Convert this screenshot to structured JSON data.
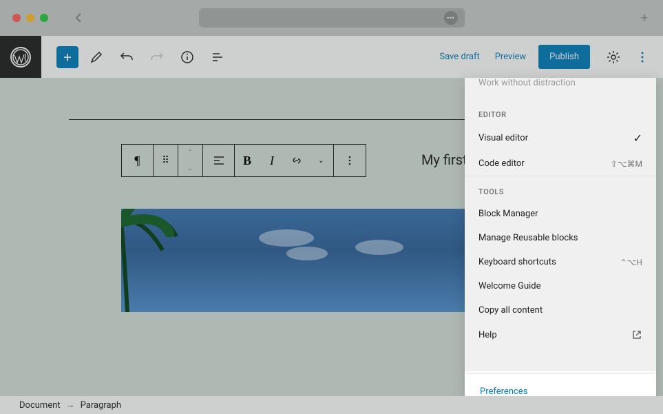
{
  "toolbar": {
    "save_draft": "Save draft",
    "preview": "Preview",
    "publish": "Publish"
  },
  "content": {
    "paragraph": "My first paragraph!"
  },
  "dropdown": {
    "distraction": "Work without distraction",
    "editor_header": "EDITOR",
    "visual_editor": "Visual editor",
    "code_editor": "Code editor",
    "code_editor_shortcut": "⇧⌥⌘M",
    "tools_header": "TOOLS",
    "block_manager": "Block Manager",
    "reusable": "Manage Reusable blocks",
    "shortcuts": "Keyboard shortcuts",
    "shortcuts_key": "⌃⌥H",
    "welcome": "Welcome Guide",
    "copy_all": "Copy all content",
    "help": "Help",
    "preferences": "Preferences"
  },
  "breadcrumb": {
    "document": "Document",
    "paragraph": "Paragraph"
  }
}
